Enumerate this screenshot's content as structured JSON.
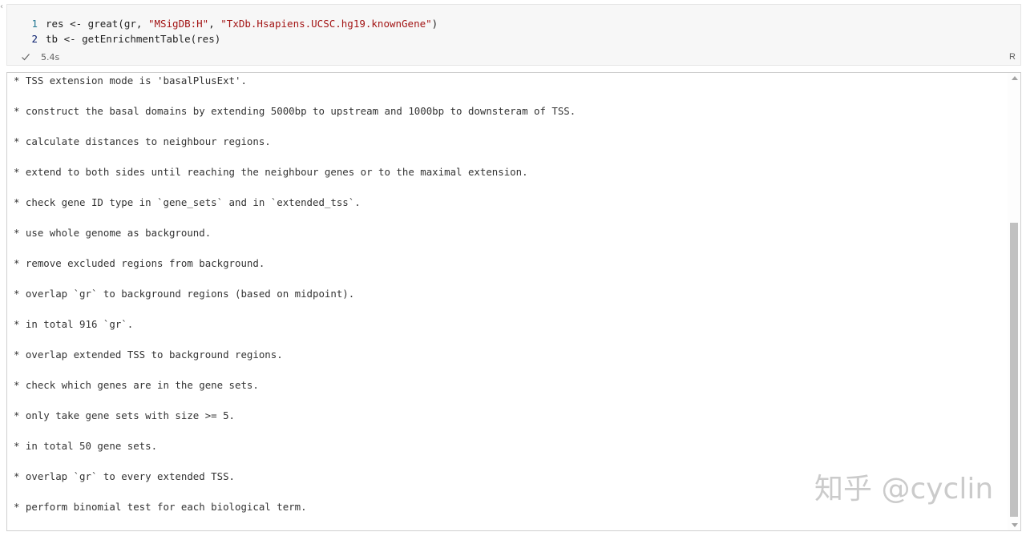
{
  "code_cell": {
    "lines": [
      {
        "number": "1",
        "tokens": [
          {
            "text": "res <- great(gr, ",
            "type": "plain"
          },
          {
            "text": "\"MSigDB:H\"",
            "type": "string"
          },
          {
            "text": ", ",
            "type": "plain"
          },
          {
            "text": "\"TxDb.Hsapiens.UCSC.hg19.knownGene\"",
            "type": "string"
          },
          {
            "text": ")",
            "type": "plain"
          }
        ]
      },
      {
        "number": "2",
        "tokens": [
          {
            "text": "tb <- getEnrichmentTable(res)",
            "type": "plain"
          }
        ]
      }
    ],
    "status_icon": "check-icon",
    "execution_time": "5.4s",
    "language": "R"
  },
  "output": {
    "lines": [
      "* TSS extension mode is 'basalPlusExt'.",
      "* construct the basal domains by extending 5000bp to upstream and 1000bp to downsteram of TSS.",
      "* calculate distances to neighbour regions.",
      "* extend to both sides until reaching the neighbour genes or to the maximal extension.",
      "* check gene ID type in `gene_sets` and in `extended_tss`.",
      "* use whole genome as background.",
      "* remove excluded regions from background.",
      "* overlap `gr` to background regions (based on midpoint).",
      "* in total 916 `gr`.",
      "* overlap extended TSS to background regions.",
      "* check which genes are in the gene sets.",
      "* only take gene sets with size >= 5.",
      "* in total 50 gene sets.",
      "* overlap `gr` to every extended TSS.",
      "* perform binomial test for each biological term."
    ]
  },
  "watermark": "知乎 @cyclin"
}
